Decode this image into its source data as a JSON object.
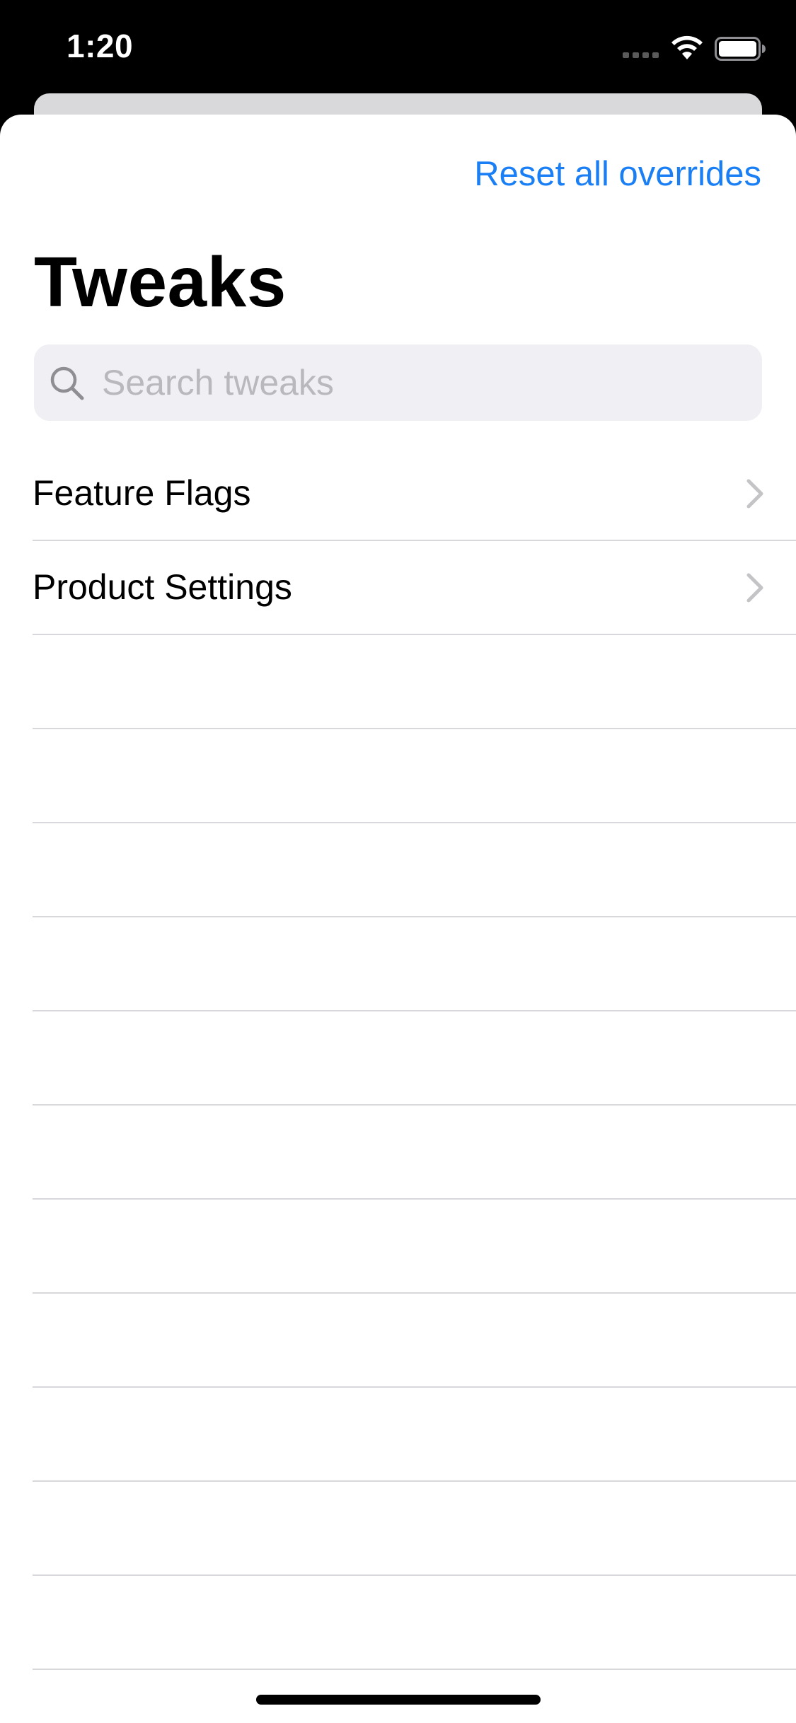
{
  "status_bar": {
    "time": "1:20",
    "icons": [
      "signal-icon",
      "wifi-icon",
      "battery-icon"
    ]
  },
  "nav": {
    "reset_label": "Reset all overrides"
  },
  "header": {
    "title": "Tweaks"
  },
  "search": {
    "placeholder": "Search tweaks",
    "value": ""
  },
  "list": {
    "items": [
      {
        "label": "Feature Flags"
      },
      {
        "label": "Product Settings"
      }
    ]
  },
  "colors": {
    "accent": "#1a7ff5",
    "separator": "#d8d8dc",
    "search_background": "#efeff4",
    "chevron": "#c4c4c7"
  }
}
